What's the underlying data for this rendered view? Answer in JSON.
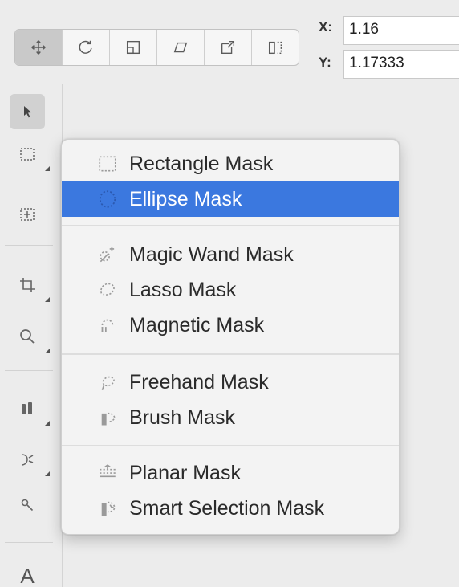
{
  "toolbar": {
    "buttons": [
      {
        "icon": "move-icon",
        "active": true
      },
      {
        "icon": "rotate-icon",
        "active": false
      },
      {
        "icon": "scale-icon",
        "active": false
      },
      {
        "icon": "skew-icon",
        "active": false
      },
      {
        "icon": "distort-icon",
        "active": false
      },
      {
        "icon": "flip-icon",
        "active": false
      }
    ],
    "x_label": "X:",
    "x_value": "1.16",
    "y_label": "Y:",
    "y_value": "1.17333"
  },
  "tools": {
    "active": "pointer-tool",
    "text_tool_label": "A"
  },
  "mask_menu": {
    "highlighted": "Ellipse Mask",
    "items": [
      {
        "label": "Rectangle Mask",
        "icon": "rectangle-mask-icon"
      },
      {
        "label": "Ellipse Mask",
        "icon": "ellipse-mask-icon"
      },
      {
        "label": "Magic Wand Mask",
        "icon": "magic-wand-mask-icon"
      },
      {
        "label": "Lasso Mask",
        "icon": "lasso-mask-icon"
      },
      {
        "label": "Magnetic Mask",
        "icon": "magnetic-mask-icon"
      },
      {
        "label": "Freehand Mask",
        "icon": "freehand-mask-icon"
      },
      {
        "label": "Brush Mask",
        "icon": "brush-mask-icon"
      },
      {
        "label": "Planar Mask",
        "icon": "planar-mask-icon"
      },
      {
        "label": "Smart Selection Mask",
        "icon": "smart-selection-mask-icon"
      }
    ]
  },
  "colors": {
    "highlight": "#3b78df",
    "background": "#ececec",
    "menu_background": "#f3f3f3"
  }
}
